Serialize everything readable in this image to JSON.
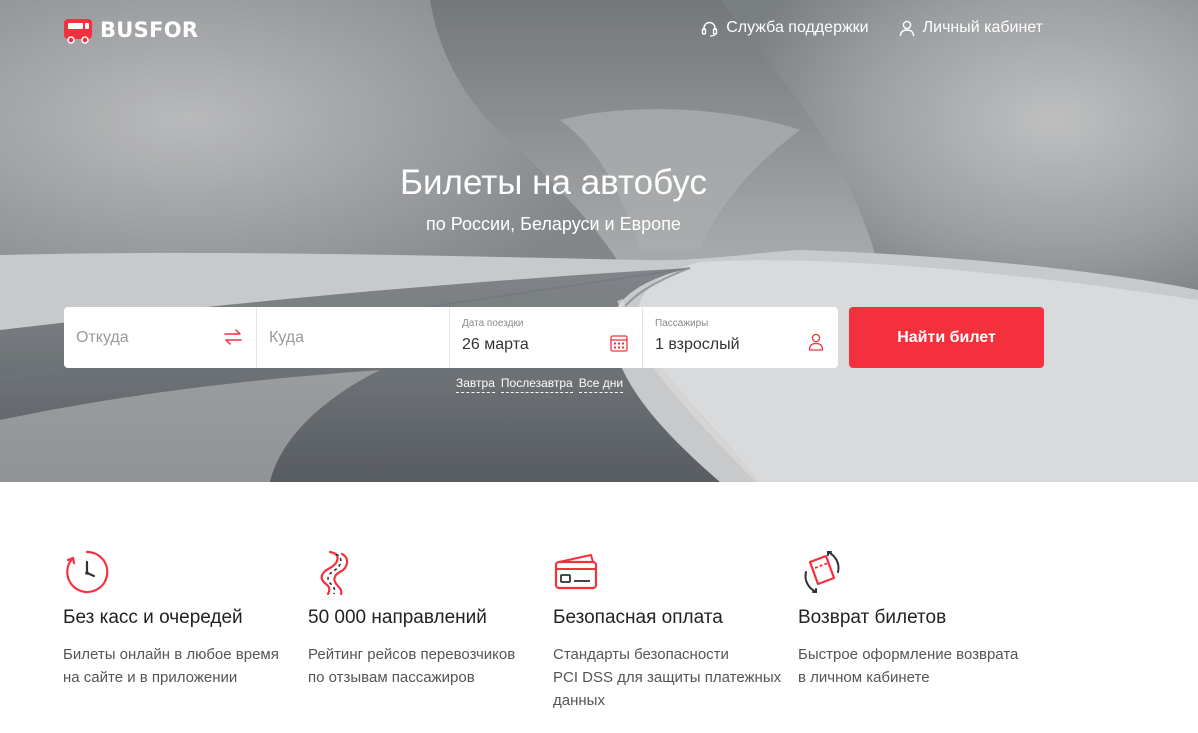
{
  "header": {
    "logo_text": "BUSFOR",
    "support_label": "Служба поддержки",
    "account_label": "Личный кабинет"
  },
  "hero": {
    "title": "Билеты на автобус",
    "subtitle": "по России, Беларуси и Европе"
  },
  "search": {
    "from_placeholder": "Откуда",
    "to_placeholder": "Куда",
    "date_label": "Дата поездки",
    "date_value": "26 марта",
    "passengers_label": "Пассажиры",
    "passengers_value": "1 взрослый",
    "submit_label": "Найти билет",
    "quick_dates": [
      "Завтра",
      "Послезавтра",
      "Все дни"
    ]
  },
  "features": [
    {
      "icon": "clock-icon",
      "title": "Без касс и очередей",
      "text": "Билеты онлайн в любое время\nна сайте и в приложении"
    },
    {
      "icon": "route-icon",
      "title": "50 000 направлений",
      "text": "Рейтинг рейсов перевозчиков\nпо отзывам пассажиров"
    },
    {
      "icon": "credit-card-icon",
      "title": "Безопасная оплата",
      "text": "Стандарты безопасности\nPCI DSS для защиты платежных\nданных"
    },
    {
      "icon": "ticket-return-icon",
      "title": "Возврат билетов",
      "text": "Быстрое оформление возврата\nв личном кабинете"
    }
  ],
  "colors": {
    "accent": "#f5303d",
    "text_dark": "#222222",
    "text_muted": "#555555"
  }
}
